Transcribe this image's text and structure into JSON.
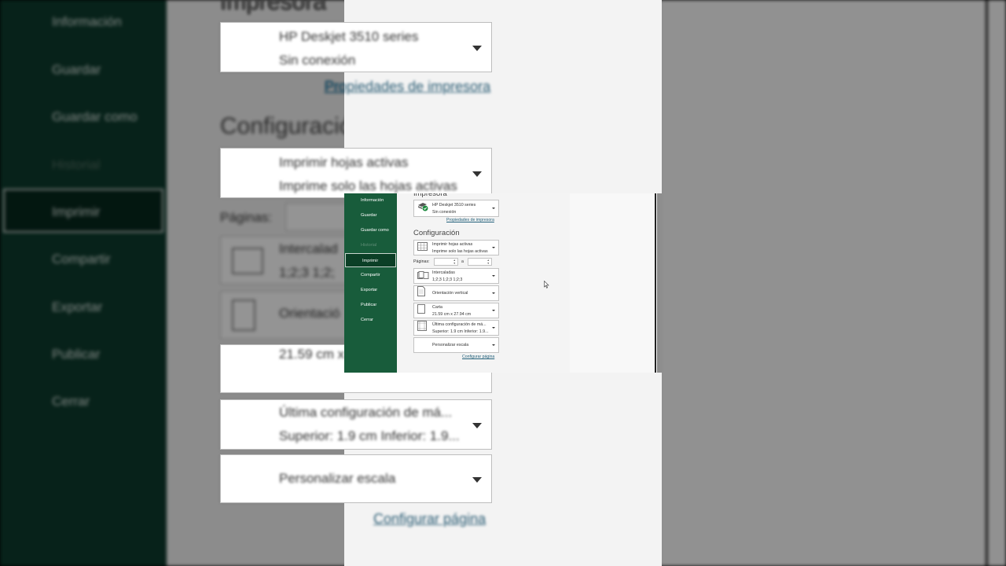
{
  "sidebar": {
    "items": [
      {
        "label": "Información"
      },
      {
        "label": "Guardar"
      },
      {
        "label": "Guardar como"
      },
      {
        "label": "Historial"
      },
      {
        "label": "Imprimir"
      },
      {
        "label": "Compartir"
      },
      {
        "label": "Exportar"
      },
      {
        "label": "Publicar"
      },
      {
        "label": "Cerrar"
      }
    ],
    "selected": "Imprimir"
  },
  "printer": {
    "section_title": "Impresora",
    "name": "HP Deskjet 3510 series",
    "status": "Sin conexión",
    "properties_link": "Propiedades de impresora",
    "icon": "printer-ok-icon"
  },
  "settings": {
    "section_title": "Configuración",
    "scope": {
      "title": "Imprimir hojas activas",
      "subtitle": "Imprime solo las hojas activas",
      "icon": "sheet-grid-icon"
    },
    "pages": {
      "label": "Páginas:",
      "separator": "a",
      "from": "",
      "to": ""
    },
    "collate": {
      "title": "Intercaladas",
      "subtitle": "1;2;3    1;2;3    1;2;3",
      "icon": "collated-pages-icon"
    },
    "orientation": {
      "title": "Orientación vertical",
      "icon": "portrait-page-icon"
    },
    "paper": {
      "title": "Carta",
      "subtitle": "21.59 cm x 27.94 cm",
      "icon": "paper-size-icon"
    },
    "margins": {
      "title": "Última configuración de má...",
      "subtitle": "Superior: 1.9 cm Inferior: 1.9...",
      "icon": "margins-icon"
    },
    "scaling": {
      "title": "Personalizar escala"
    },
    "page_setup_link": "Configurar página"
  },
  "background": {
    "collate_partial": "Intercalad",
    "collate_sub_partial": "1;2;3      1;2;",
    "orientation_partial": "Orientació"
  }
}
